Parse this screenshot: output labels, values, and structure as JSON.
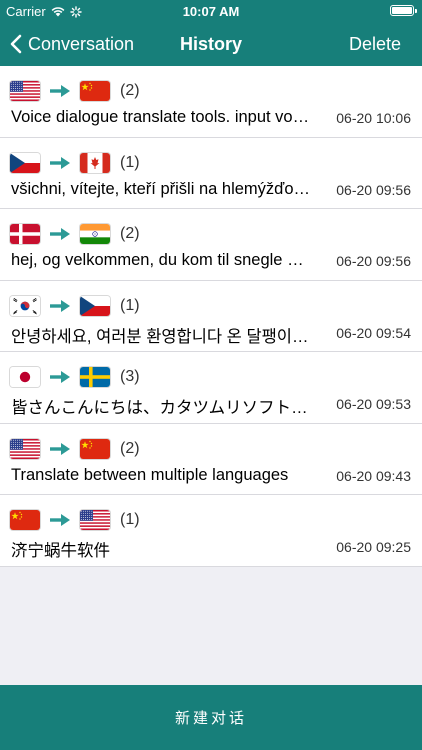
{
  "status_bar": {
    "carrier": "Carrier",
    "time": "10:07 AM"
  },
  "nav": {
    "back_label": "Conversation",
    "title": "History",
    "delete_label": "Delete"
  },
  "colors": {
    "accent": "#177f7a",
    "arrow": "#2c9a96"
  },
  "history": [
    {
      "from_flag": "us-flag-icon",
      "to_flag": "china-flag-icon",
      "count": "(2)",
      "text": "Voice dialogue translate tools.  input voice and translate",
      "time": "06-20 10:06"
    },
    {
      "from_flag": "czech-flag-icon",
      "to_flag": "canada-flag-icon",
      "count": "(1)",
      "text": "všichni, vítejte, kteří přišli na hlemýžďový software",
      "time": "06-20 09:56"
    },
    {
      "from_flag": "denmark-flag-icon",
      "to_flag": "india-flag-icon",
      "count": "(2)",
      "text": "hej, og velkommen, du kom til snegle software",
      "time": "06-20 09:56"
    },
    {
      "from_flag": "korea-flag-icon",
      "to_flag": "czech-flag-icon",
      "count": "(1)",
      "text": "안녕하세요, 여러분 환영합니다 온 달팽이 소프트웨어",
      "time": "06-20 09:54"
    },
    {
      "from_flag": "japan-flag-icon",
      "to_flag": "sweden-flag-icon",
      "count": "(3)",
      "text": "皆さんこんにちは、カタツムリソフトウェアへようこそ",
      "time": "06-20 09:53"
    },
    {
      "from_flag": "us-flag-icon",
      "to_flag": "china-flag-icon",
      "count": "(2)",
      "text": "Translate between multiple languages",
      "time": "06-20 09:43"
    },
    {
      "from_flag": "china-flag-icon",
      "to_flag": "us-flag-icon",
      "count": "(1)",
      "text": "济宁蜗牛软件",
      "time": "06-20 09:25"
    }
  ],
  "new_conversation_label": "新建对话"
}
